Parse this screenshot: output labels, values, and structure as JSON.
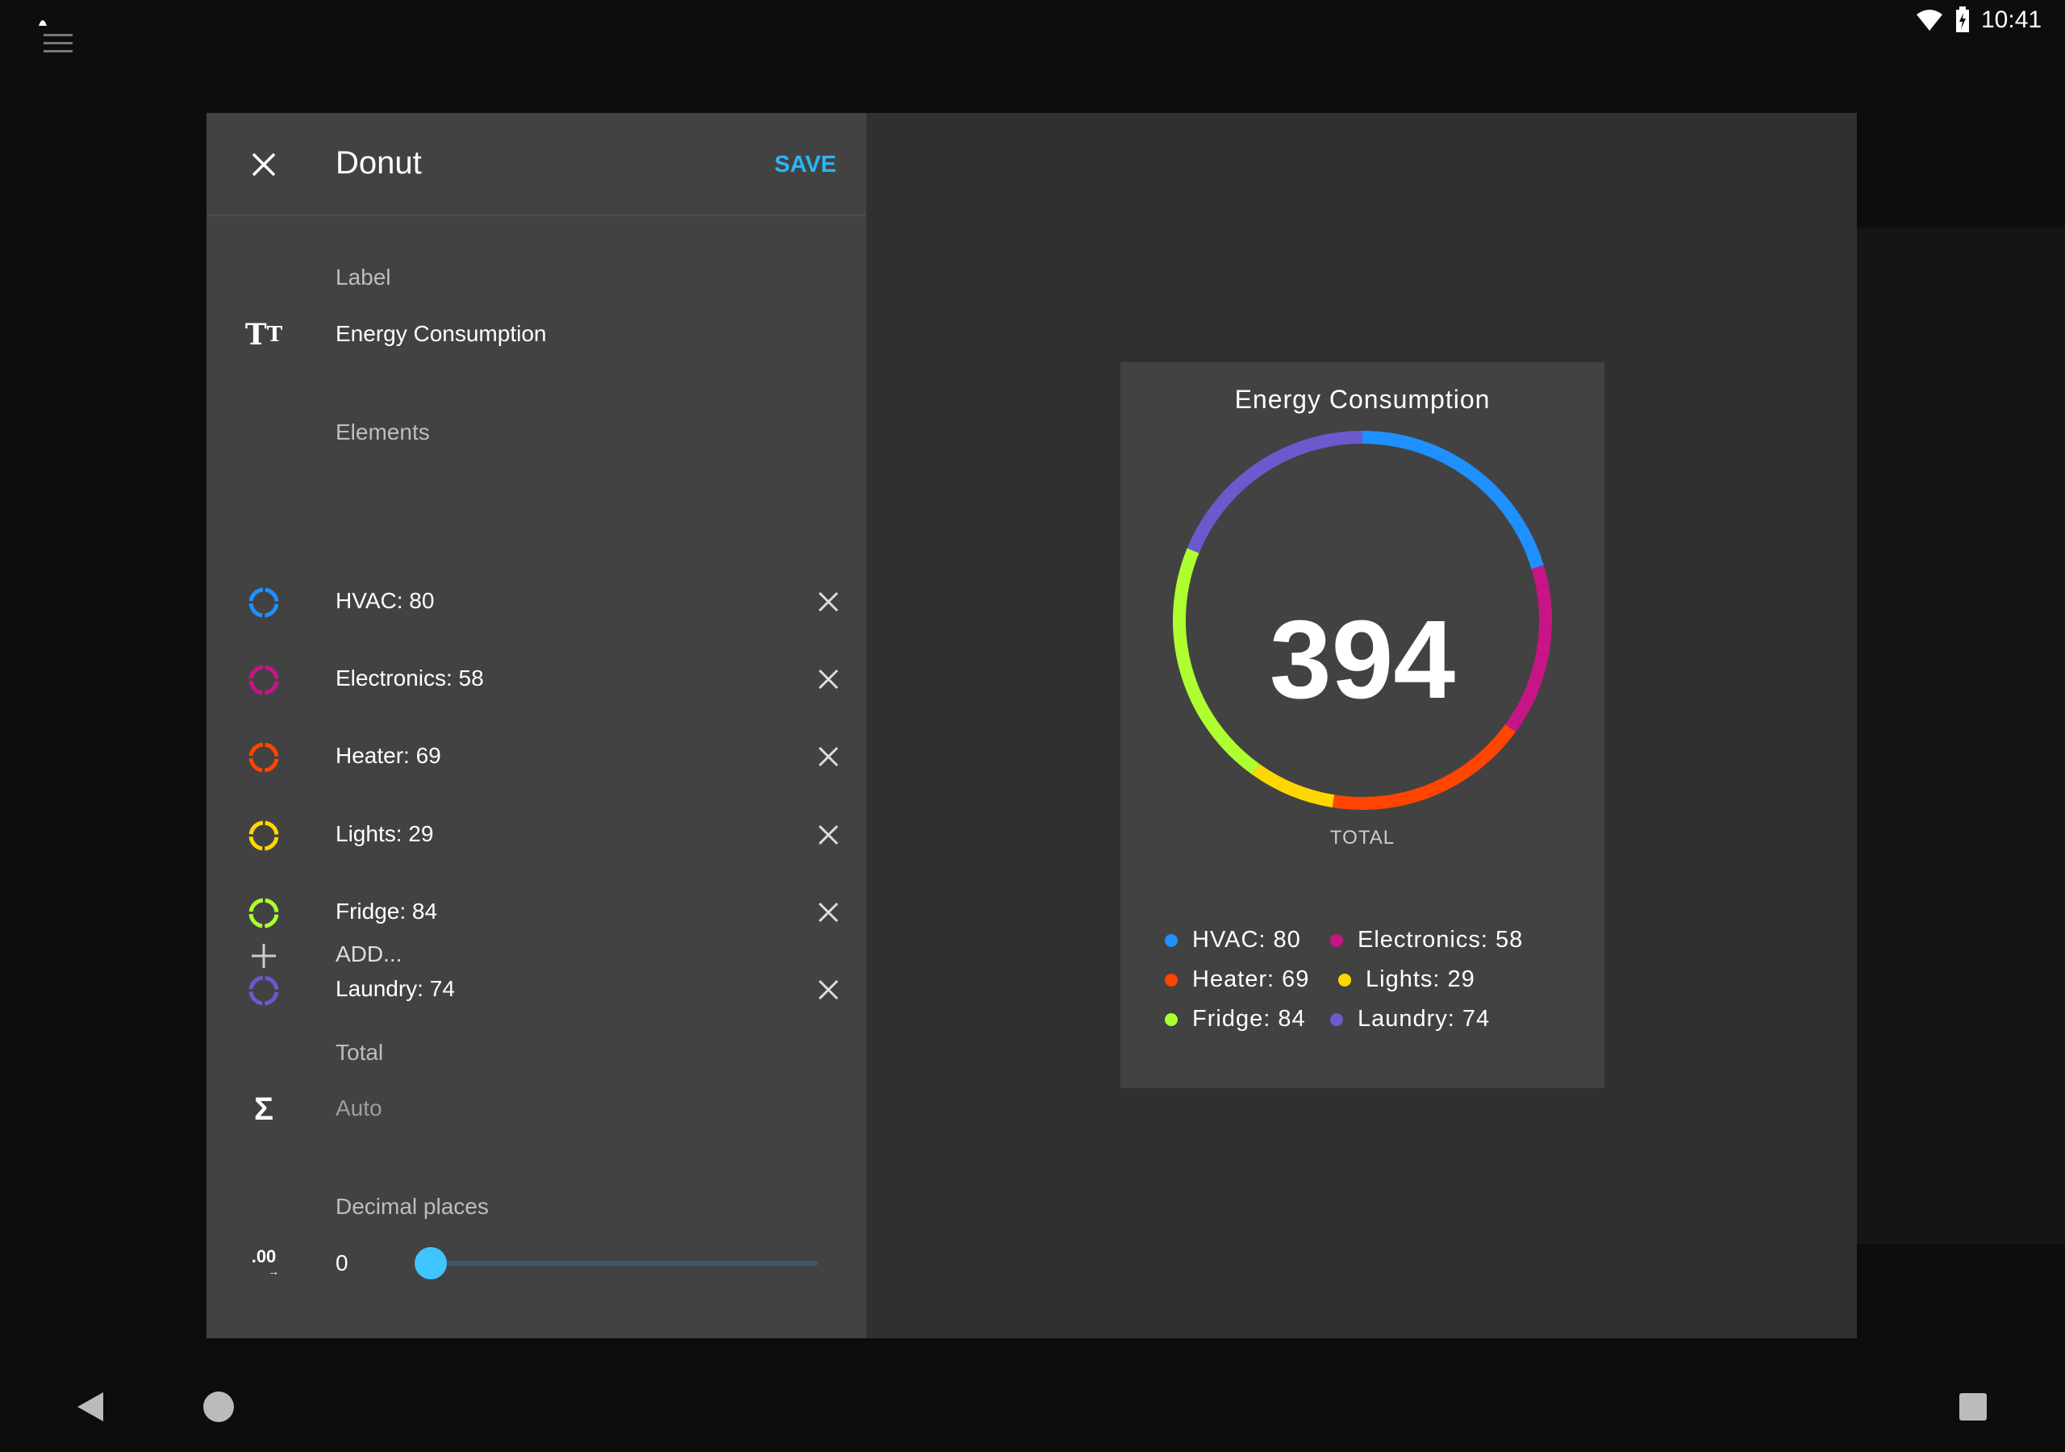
{
  "status_bar": {
    "time": "10:41"
  },
  "dialog": {
    "title": "Donut",
    "save_label": "SAVE",
    "label_caption": "Label",
    "label_value": "Energy Consumption",
    "elements_caption": "Elements",
    "elements": [
      {
        "label": "HVAC: 80",
        "color": "#1e90ff"
      },
      {
        "label": "Electronics: 58",
        "color": "#c71585"
      },
      {
        "label": "Heater: 69",
        "color": "#ff4500"
      },
      {
        "label": "Lights: 29",
        "color": "#ffd700"
      },
      {
        "label": "Fridge: 84",
        "color": "#adff2f"
      },
      {
        "label": "Laundry: 74",
        "color": "#6a5acd"
      }
    ],
    "add_label": "ADD...",
    "total_caption": "Total",
    "total_value": "Auto",
    "decimal_caption": "Decimal places",
    "decimal_value": "0",
    "decimal_icon_text": ".00"
  },
  "chart_data": {
    "type": "pie",
    "title": "Energy Consumption",
    "center_value": "394",
    "center_label": "TOTAL",
    "categories": [
      "HVAC",
      "Electronics",
      "Heater",
      "Lights",
      "Fridge",
      "Laundry"
    ],
    "values": [
      80,
      58,
      69,
      29,
      84,
      74
    ],
    "colors": [
      "#1e90ff",
      "#c71585",
      "#ff4500",
      "#ffd700",
      "#adff2f",
      "#6a5acd"
    ],
    "legend": [
      "HVAC: 80",
      "Electronics: 58",
      "Heater: 69",
      "Lights: 29",
      "Fridge: 84",
      "Laundry: 74"
    ]
  }
}
